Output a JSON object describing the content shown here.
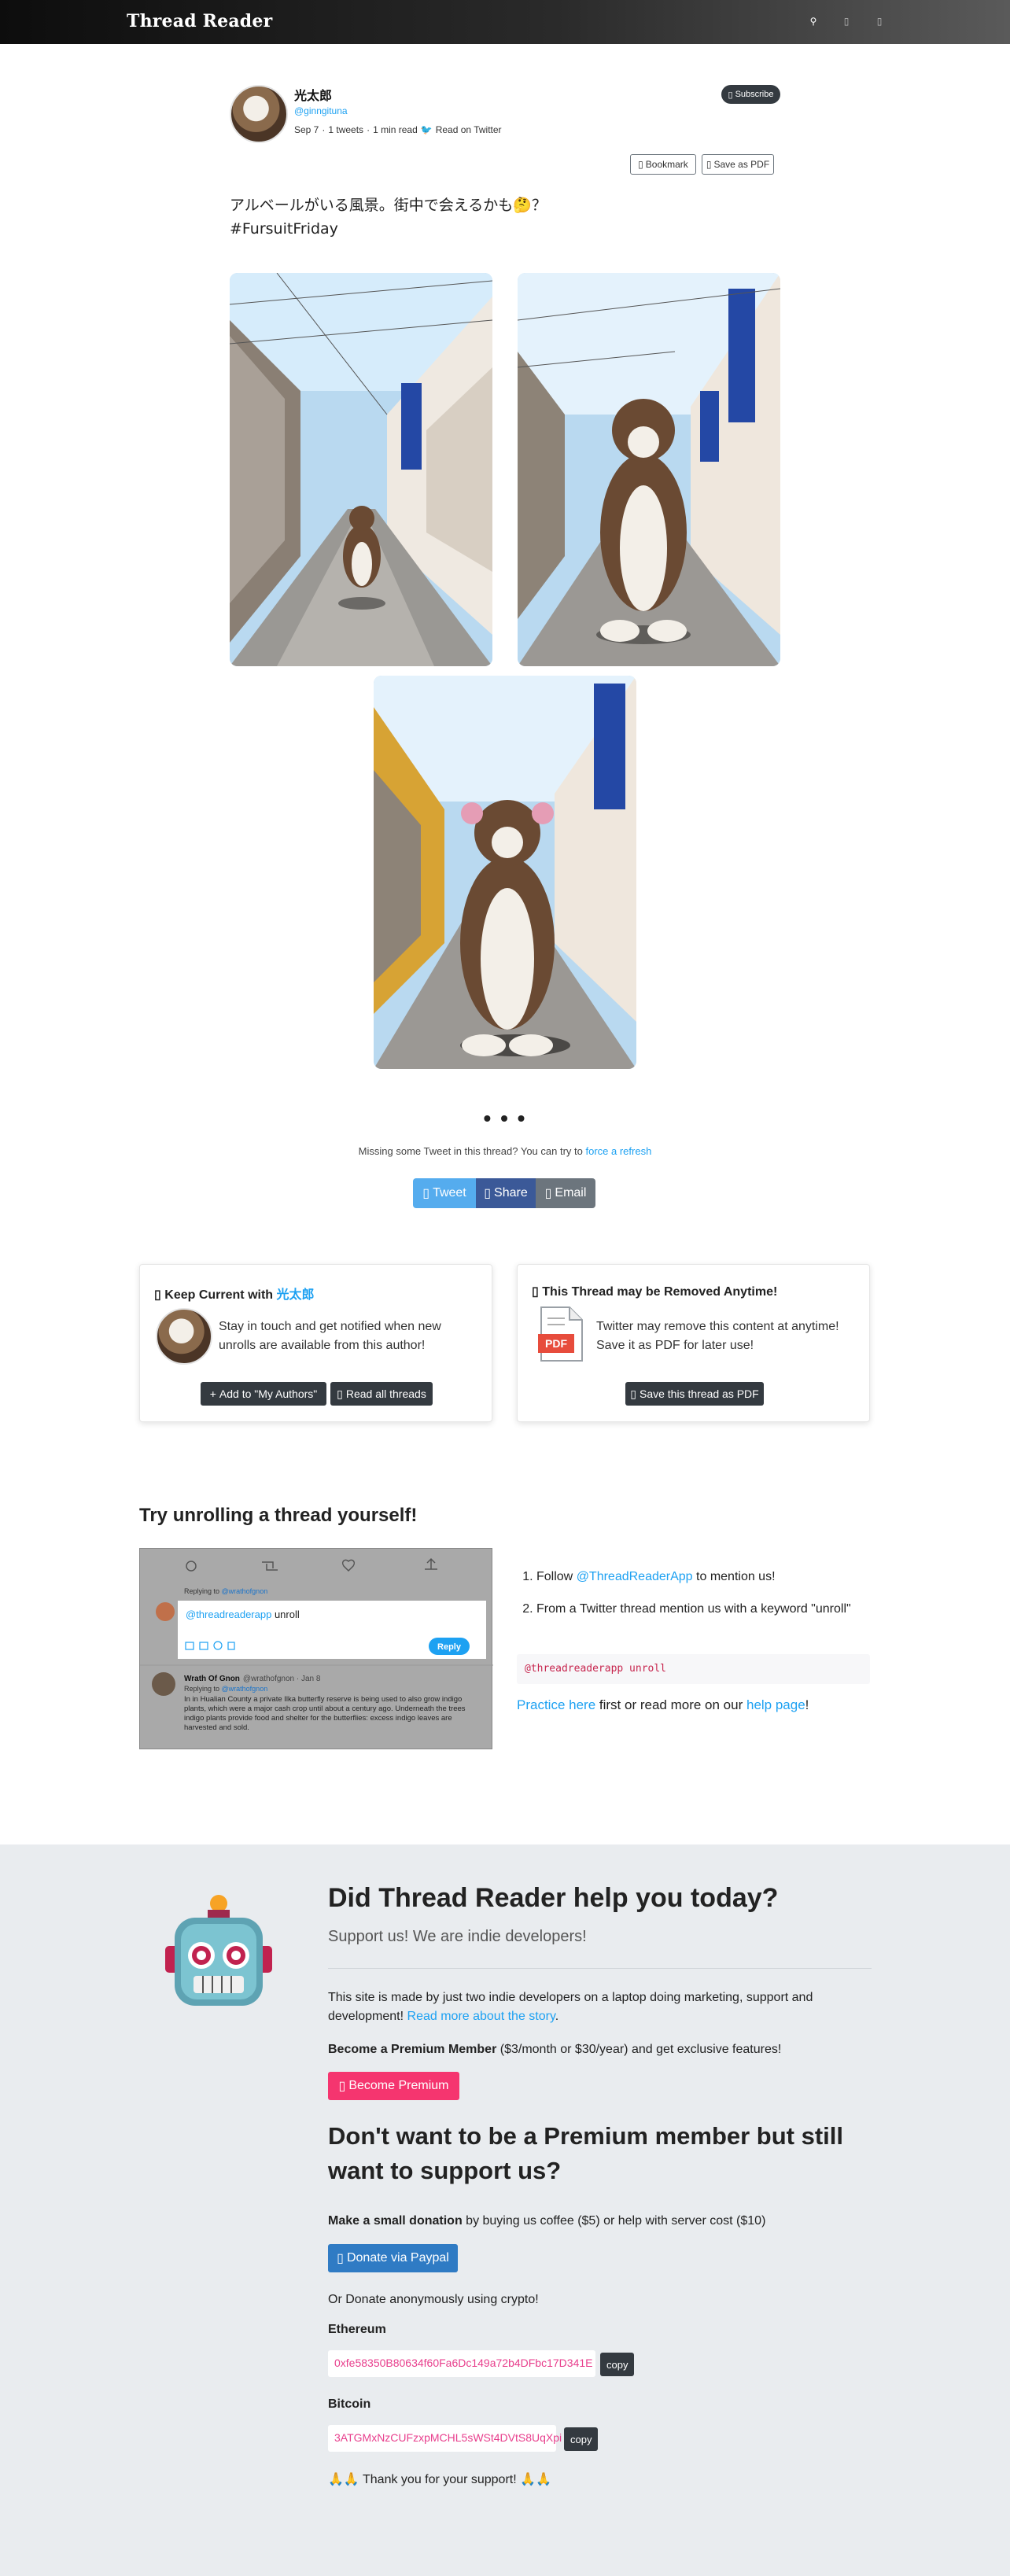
{
  "nav": {
    "brand": "Thread Reader",
    "icons": [
      "search-icon",
      "user-icon",
      "menu-icon"
    ]
  },
  "author": {
    "name": "光太郎",
    "handle": "@ginngituna",
    "date": "Sep 7",
    "tweets": "1 tweets",
    "read_time": "1 min read",
    "read_on": "Read on Twitter",
    "subscribe_label": "Subscribe",
    "bookmark_label": "Bookmark",
    "save_pdf_label": "Save as PDF",
    "meta_sep": "·"
  },
  "tweet": {
    "line1": "アルベールがいる風景。街中で会えるかも🤔？",
    "line2": "#FursuitFriday"
  },
  "thread_end": {
    "ellipsis": "• • •",
    "missing_text": "Missing some Tweet in this thread? You can try to ",
    "refresh_link": "force a refresh"
  },
  "share": {
    "tweet_label": "Tweet",
    "share_label": "Share",
    "email_label": "Email",
    "colors": {
      "tweet": "#55acee",
      "share": "#3b5998",
      "email": "#6c757d"
    }
  },
  "keep_current": {
    "title_prefix": "Keep Current with ",
    "title_name": "光太郎",
    "text": "Stay in touch and get notified when new unrolls are available from this author!",
    "add_label": "Add to \"My Authors\"",
    "read_all_label": "Read all threads"
  },
  "removed_card": {
    "title": "This Thread may be Removed Anytime!",
    "text": "Twitter may remove this content at anytime! Save it as PDF for later use!",
    "pdf_badge": "PDF",
    "save_label": "Save this thread as PDF"
  },
  "unroll": {
    "title": "Try unrolling a thread yourself!",
    "mock": {
      "replying_to": "Replying to ",
      "replying_handle": "@wrathofgnon",
      "compose_mention": "@threadreaderapp",
      "compose_word": " unroll",
      "reply_label": "Reply",
      "author": "Wrath Of Gnon",
      "author_meta": "@wrathofgnon · Jan 8",
      "body": "In in Hualian County a private Ilka butterfly reserve is being used to also grow indigo plants, which were a major cash crop until about a century ago. Underneath the trees indigo plants provide food and shelter for the butterflies: excess indigo leaves are harvested and sold."
    },
    "step1_prefix": "Follow ",
    "step1_link": "@ThreadReaderApp",
    "step1_suffix": " to mention us!",
    "step2": "From a Twitter thread mention us with a keyword \"unroll\"",
    "code": "@threadreaderapp unroll",
    "practice_link": "Practice here",
    "practice_mid": " first or read more on our ",
    "help_link": "help page",
    "practice_end": "!"
  },
  "support": {
    "title": "Did Thread Reader help you today?",
    "lead": "Support us! We are indie developers!",
    "p1": "This site is made by just two indie developers on a laptop doing marketing, support and development! ",
    "p1_link": "Read more about the story",
    "p1_end": ".",
    "premium_bold": "Become a Premium Member",
    "premium_rest": " ($3/month or $30/year) and get exclusive features!",
    "premium_btn": "Become Premium",
    "title2": "Don't want to be a Premium member but still want to support us?",
    "donation_bold": "Make a small donation",
    "donation_rest": " by buying us coffee ($5) or help with server cost ($10)",
    "paypal_btn": "Donate via Paypal",
    "crypto_intro": "Or Donate anonymously using crypto!",
    "eth_label": "Ethereum",
    "eth_addr": "0xfe58350B80634f60Fa6Dc149a72b4DFbc17D341E",
    "btc_label": "Bitcoin",
    "btc_addr": "3ATGMxNzCUFzxpMCHL5sWSt4DVtS8UqXpi",
    "copy_label": "copy",
    "thanks": "🙏🙏 Thank you for your support! 🙏🙏"
  }
}
